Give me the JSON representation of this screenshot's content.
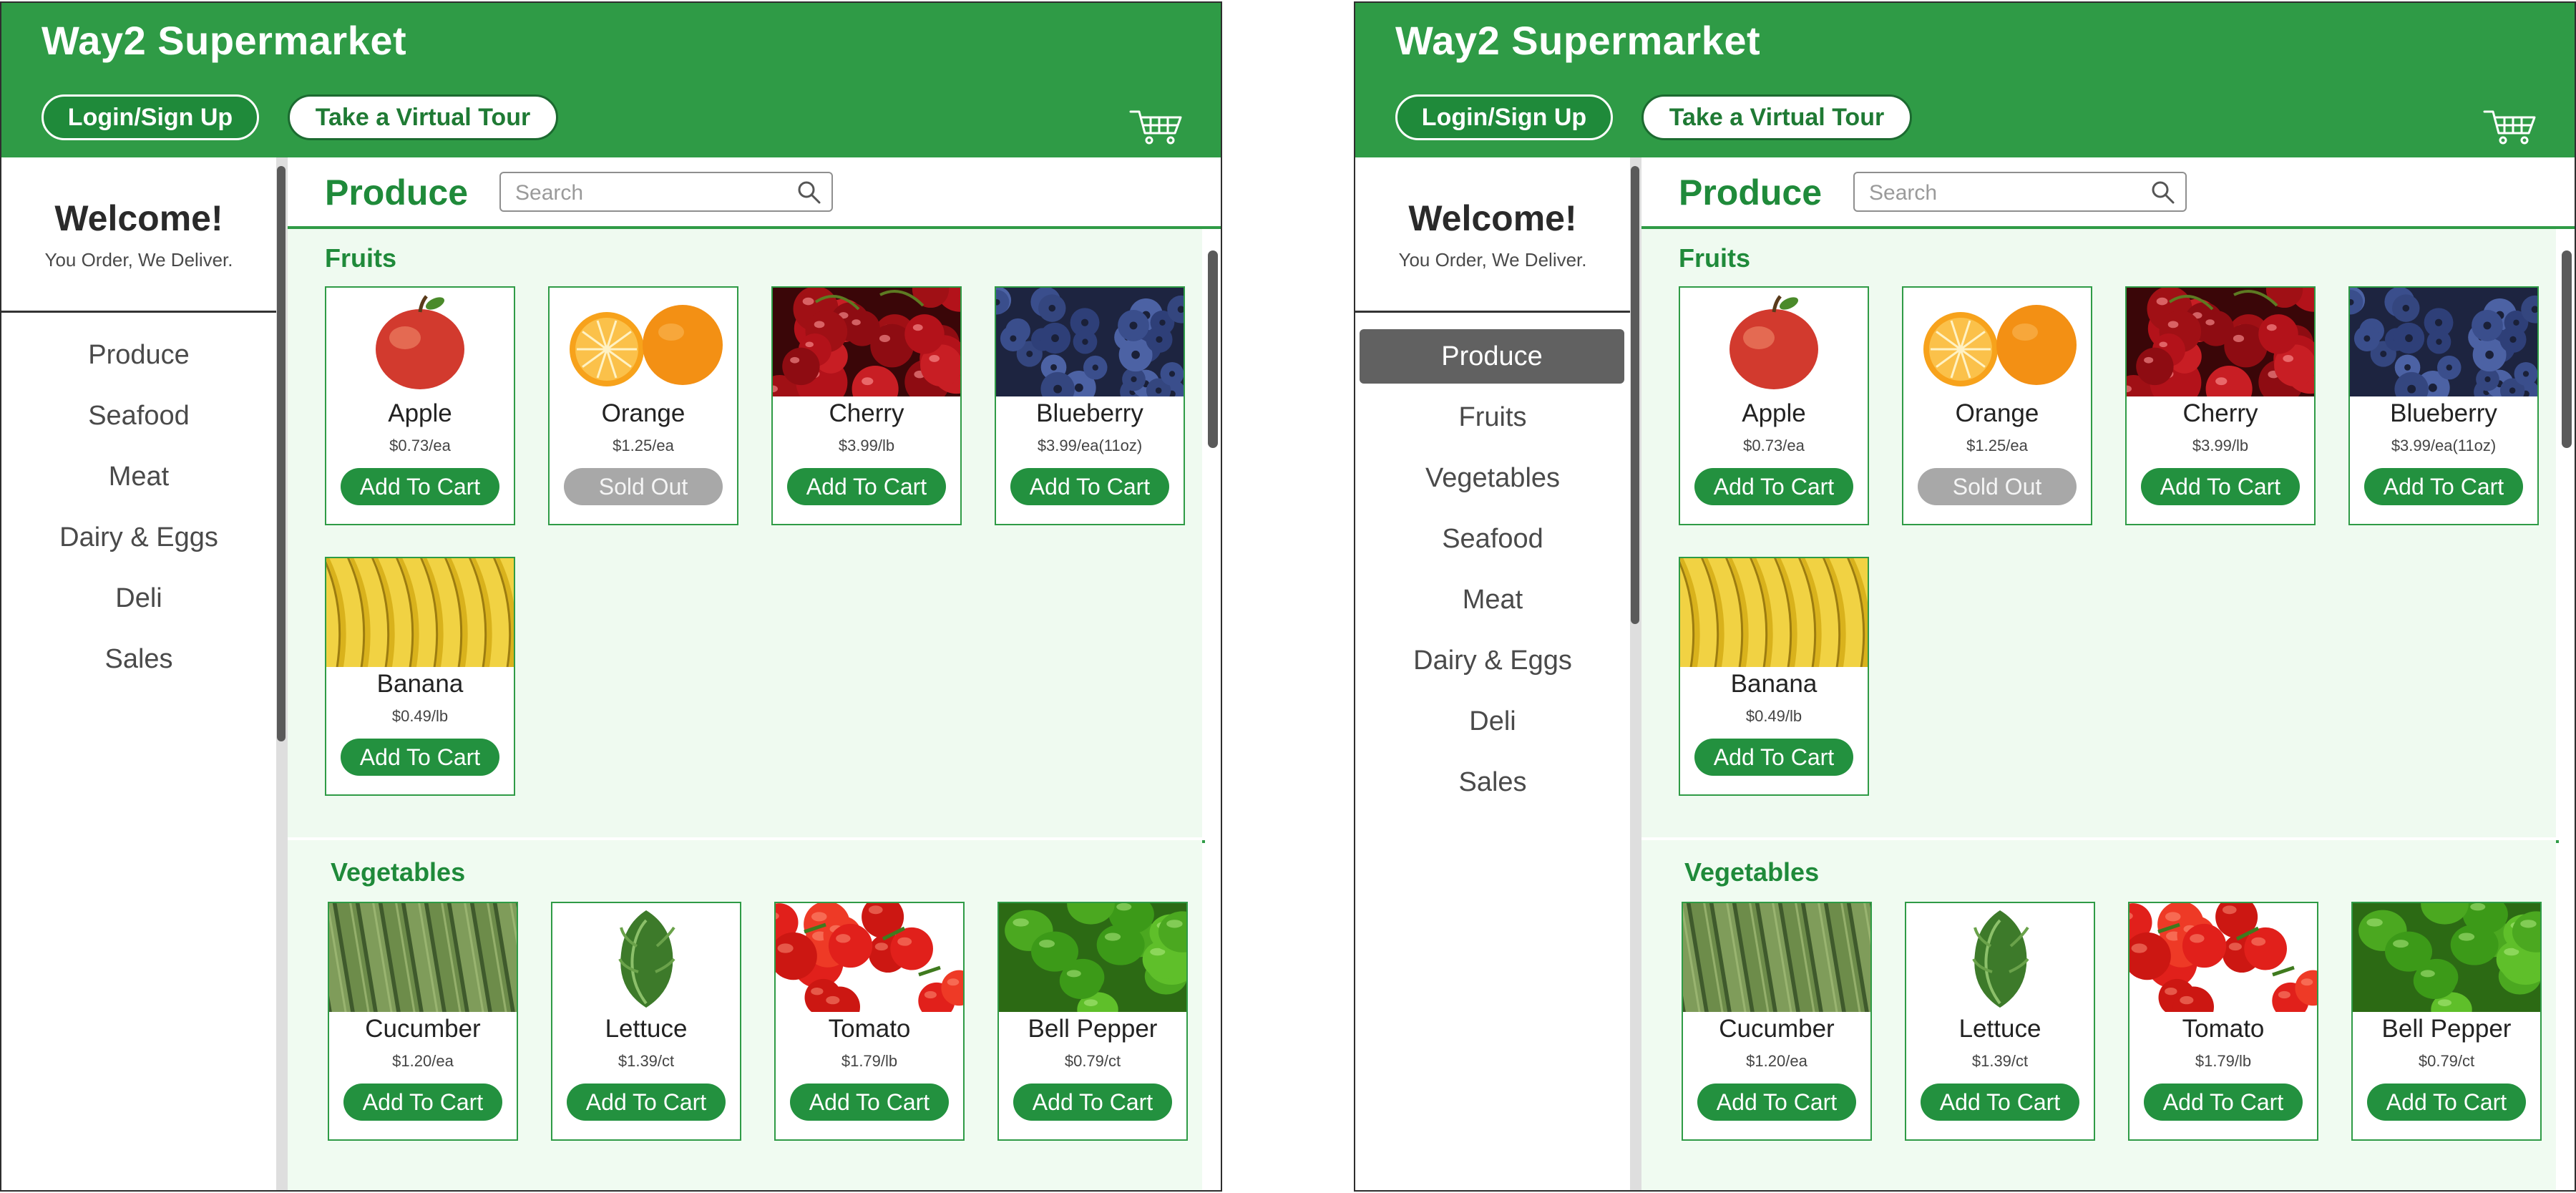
{
  "app": {
    "brand": "Way2 Supermarket",
    "login_label": "Login/Sign Up",
    "tour_label": "Take a Virtual Tour"
  },
  "sidebar": {
    "welcome": "Welcome!",
    "tagline": "You Order, We Deliver."
  },
  "screen_left": {
    "nav": [
      "Produce",
      "Seafood",
      "Meat",
      "Dairy & Eggs",
      "Deli",
      "Sales"
    ]
  },
  "screen_right": {
    "nav": [
      "Produce",
      "Fruits",
      "Vegetables",
      "Seafood",
      "Meat",
      "Dairy & Eggs",
      "Deli",
      "Sales"
    ],
    "active": "Produce"
  },
  "main": {
    "title": "Produce",
    "search_placeholder": "Search",
    "fruits_title": "Fruits",
    "vegetables_title": "Vegetables"
  },
  "fruits": [
    {
      "name": "Apple",
      "price": "$0.73/ea",
      "button": "Add To Cart",
      "icon": "apple"
    },
    {
      "name": "Orange",
      "price": "$1.25/ea",
      "button": "Sold Out",
      "icon": "orange"
    },
    {
      "name": "Cherry",
      "price": "$3.99/lb",
      "button": "Add To Cart",
      "icon": "cherry"
    },
    {
      "name": "Blueberry",
      "price": "$3.99/ea(11oz)",
      "button": "Add To Cart",
      "icon": "blueberry"
    },
    {
      "name": "Banana",
      "price": "$0.49/lb",
      "button": "Add To Cart",
      "icon": "banana"
    }
  ],
  "vegetables": [
    {
      "name": "Cucumber",
      "price": "$1.20/ea",
      "button": "Add To Cart",
      "icon": "cucumber"
    },
    {
      "name": "Lettuce",
      "price": "$1.39/ct",
      "button": "Add To Cart",
      "icon": "lettuce"
    },
    {
      "name": "Tomato",
      "price": "$1.79/lb",
      "button": "Add To Cart",
      "icon": "tomato"
    },
    {
      "name": "Bell Pepper",
      "price": "$0.79/ct",
      "button": "Add To Cart",
      "icon": "bell-pepper"
    }
  ],
  "colors": {
    "brand_green": "#2f9b46",
    "sold_out": "#a8a8a8",
    "active_nav": "#616161"
  }
}
